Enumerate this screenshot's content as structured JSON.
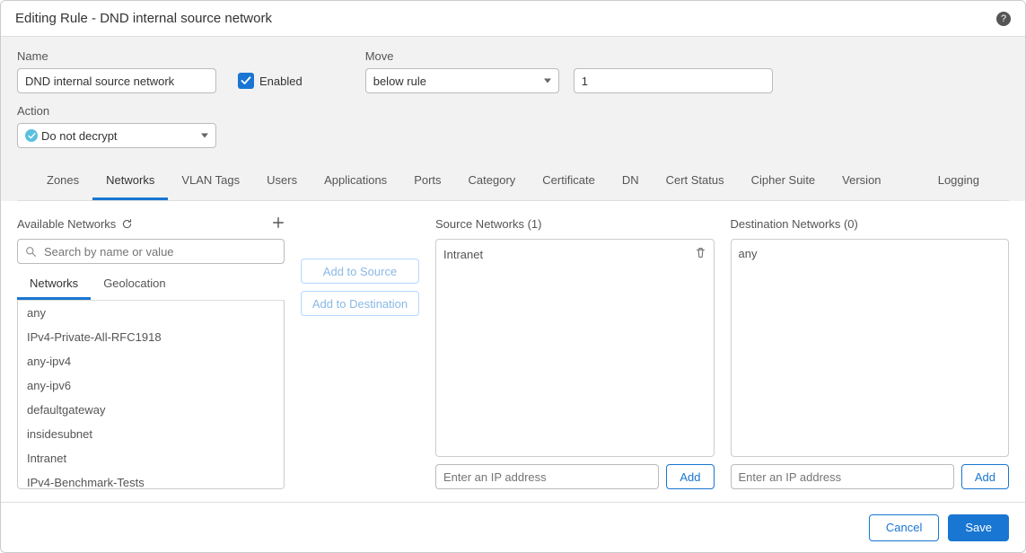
{
  "header": {
    "title": "Editing Rule - DND internal source network"
  },
  "form": {
    "name_label": "Name",
    "name_value": "DND internal source network",
    "enabled_label": "Enabled",
    "enabled_checked": true,
    "move_label": "Move",
    "move_select_value": "below rule",
    "move_number_value": "1",
    "action_label": "Action",
    "action_value": "Do not decrypt"
  },
  "tabs": [
    "Zones",
    "Networks",
    "VLAN Tags",
    "Users",
    "Applications",
    "Ports",
    "Category",
    "Certificate",
    "DN",
    "Cert Status",
    "Cipher Suite",
    "Version"
  ],
  "logging_tab": "Logging",
  "active_tab_index": 1,
  "available": {
    "title": "Available Networks",
    "search_placeholder": "Search by name or value",
    "subtabs": [
      "Networks",
      "Geolocation"
    ],
    "active_subtab_index": 0,
    "items": [
      "any",
      "IPv4-Private-All-RFC1918",
      "any-ipv4",
      "any-ipv6",
      "defaultgateway",
      "insidesubnet",
      "Intranet",
      "IPv4-Benchmark-Tests"
    ]
  },
  "buttons": {
    "add_source": "Add to Source",
    "add_destination": "Add to Destination"
  },
  "source": {
    "title": "Source Networks (1)",
    "items": [
      "Intranet"
    ],
    "ip_placeholder": "Enter an IP address",
    "add_label": "Add"
  },
  "destination": {
    "title": "Destination Networks (0)",
    "items": [
      "any"
    ],
    "ip_placeholder": "Enter an IP address",
    "add_label": "Add"
  },
  "footer": {
    "cancel": "Cancel",
    "save": "Save"
  }
}
